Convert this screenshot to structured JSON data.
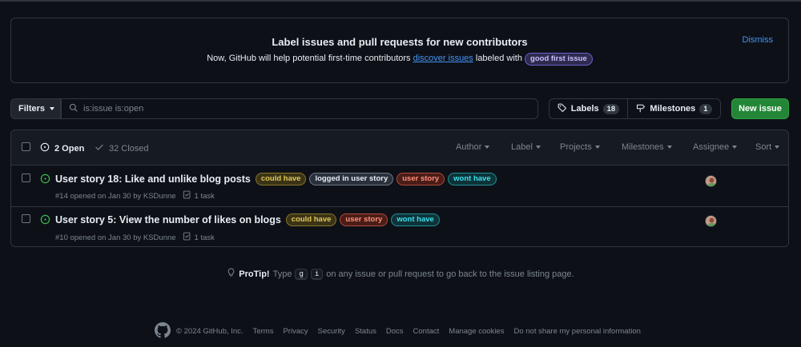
{
  "banner": {
    "title": "Label issues and pull requests for new contributors",
    "sub_prefix": "Now, GitHub will help potential first-time contributors ",
    "sub_link": "discover issues",
    "sub_suffix": " labeled with ",
    "label": "good first issue",
    "dismiss": "Dismiss"
  },
  "toolbar": {
    "filters_label": "Filters",
    "search_value": "is:issue is:open",
    "labels_label": "Labels",
    "labels_count": "18",
    "milestones_label": "Milestones",
    "milestones_count": "1",
    "new_issue_label": "New issue"
  },
  "issues_header": {
    "open_label": "2 Open",
    "closed_label": "32 Closed",
    "filters": [
      "Author",
      "Label",
      "Projects",
      "Milestones",
      "Assignee",
      "Sort"
    ]
  },
  "issues": [
    {
      "title": "User story 18: Like and unlike blog posts",
      "labels": [
        "could have",
        "logged in user story",
        "user story",
        "wont have"
      ],
      "meta": "#14 opened on Jan 30 by KSDunne",
      "tasks": "1 task"
    },
    {
      "title": "User story 5: View the number of likes on blogs",
      "labels": [
        "could have",
        "user story",
        "wont have"
      ],
      "meta": "#10 opened on Jan 30 by KSDunne",
      "tasks": "1 task"
    }
  ],
  "protip": {
    "title": "ProTip!",
    "pre": "Type",
    "key1": "g",
    "key2": "i",
    "post": "on any issue or pull request to go back to the issue listing page."
  },
  "footer": {
    "copyright": "© 2024 GitHub, Inc.",
    "links": [
      "Terms",
      "Privacy",
      "Security",
      "Status",
      "Docs",
      "Contact",
      "Manage cookies",
      "Do not share my personal information"
    ]
  },
  "colors": {
    "background": "#0d1117",
    "accent_link": "#4493f8",
    "open_green": "#3fb950",
    "button_green": "#238636"
  },
  "icons": [
    "issue-open-icon",
    "check-icon",
    "search-icon",
    "tag-icon",
    "milestone-icon",
    "task-list-icon",
    "light-bulb-icon",
    "github-logo-icon",
    "avatar"
  ]
}
